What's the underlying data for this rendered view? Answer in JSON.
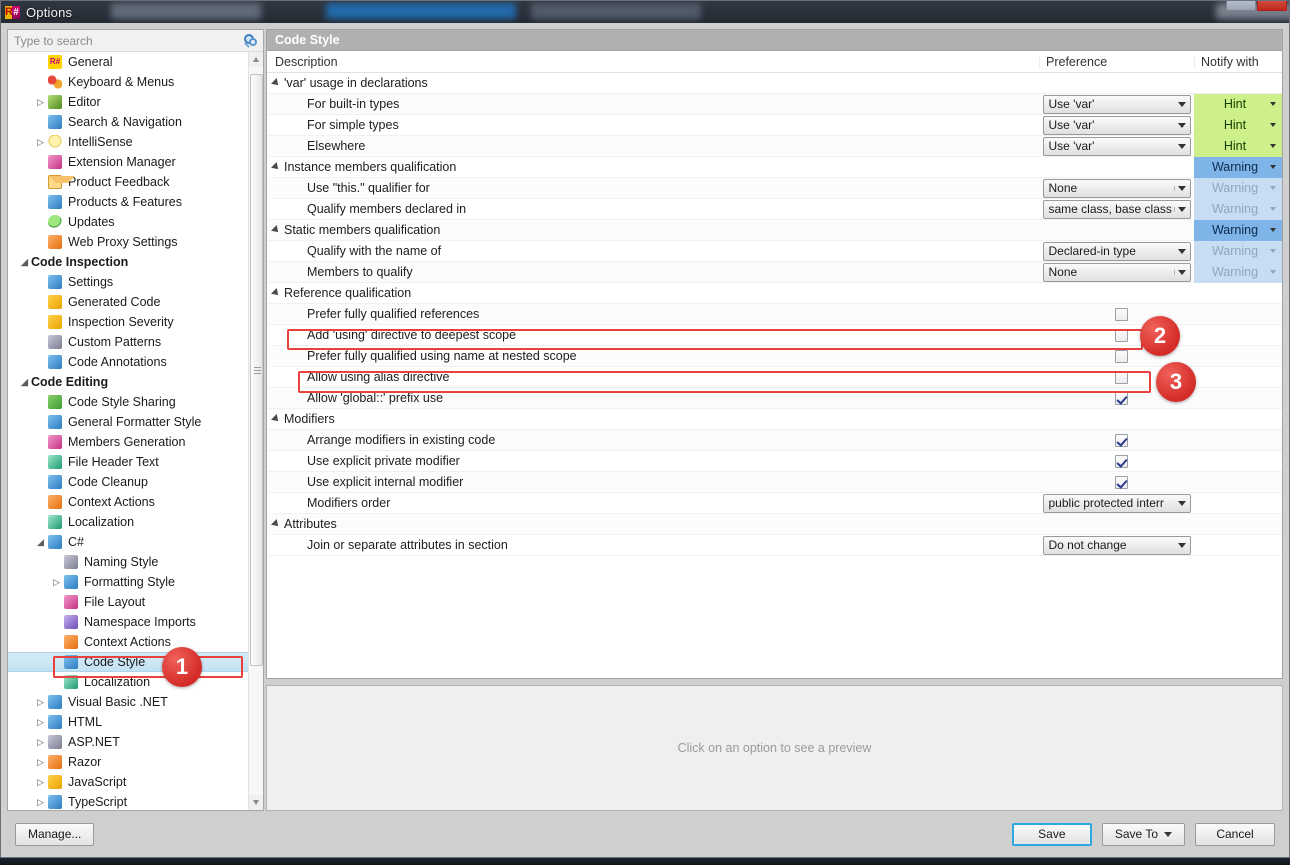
{
  "window": {
    "title": "Options",
    "app_icon": "resharper-icon",
    "minimize_label": "_",
    "close_label": "X"
  },
  "sidebar": {
    "search": {
      "placeholder": "Type to search",
      "value": "",
      "icon": "search-icon"
    },
    "scrollbar": {
      "up_icon": "scroll-up-arrow-icon",
      "down_icon": "scroll-down-arrow-icon"
    },
    "items": [
      {
        "label": "General",
        "indent": 1,
        "expander": "",
        "icon": "resharper-icon",
        "group": false,
        "selected": false
      },
      {
        "label": "Keyboard & Menus",
        "indent": 1,
        "expander": "",
        "icon": "keyboard-menus-icon",
        "group": false,
        "selected": false
      },
      {
        "label": "Editor",
        "indent": 1,
        "expander": "▷",
        "icon": "editor-pencil-icon",
        "group": false,
        "selected": false
      },
      {
        "label": "Search & Navigation",
        "indent": 1,
        "expander": "",
        "icon": "magnifier-icon",
        "group": false,
        "selected": false
      },
      {
        "label": "IntelliSense",
        "indent": 1,
        "expander": "▷",
        "icon": "lightbulb-icon",
        "group": false,
        "selected": false
      },
      {
        "label": "Extension Manager",
        "indent": 1,
        "expander": "",
        "icon": "extension-manager-icon",
        "group": false,
        "selected": false
      },
      {
        "label": "Product Feedback",
        "indent": 1,
        "expander": "",
        "icon": "envelope-icon",
        "group": false,
        "selected": false
      },
      {
        "label": "Products & Features",
        "indent": 1,
        "expander": "",
        "icon": "products-features-icon",
        "group": false,
        "selected": false
      },
      {
        "label": "Updates",
        "indent": 1,
        "expander": "",
        "icon": "updates-globe-icon",
        "group": false,
        "selected": false
      },
      {
        "label": "Web Proxy Settings",
        "indent": 1,
        "expander": "",
        "icon": "web-proxy-icon",
        "group": false,
        "selected": false
      },
      {
        "label": "Code Inspection",
        "indent": 0,
        "expander": "◢",
        "icon": "",
        "group": true,
        "selected": false
      },
      {
        "label": "Settings",
        "indent": 1,
        "expander": "",
        "icon": "settings-icon",
        "group": false,
        "selected": false
      },
      {
        "label": "Generated Code",
        "indent": 1,
        "expander": "",
        "icon": "generated-code-icon",
        "group": false,
        "selected": false
      },
      {
        "label": "Inspection Severity",
        "indent": 1,
        "expander": "",
        "icon": "inspection-severity-icon",
        "group": false,
        "selected": false
      },
      {
        "label": "Custom Patterns",
        "indent": 1,
        "expander": "",
        "icon": "custom-patterns-icon",
        "group": false,
        "selected": false
      },
      {
        "label": "Code Annotations",
        "indent": 1,
        "expander": "",
        "icon": "code-annotations-icon",
        "group": false,
        "selected": false
      },
      {
        "label": "Code Editing",
        "indent": 0,
        "expander": "◢",
        "icon": "",
        "group": true,
        "selected": false
      },
      {
        "label": "Code Style Sharing",
        "indent": 1,
        "expander": "",
        "icon": "code-style-sharing-icon",
        "group": false,
        "selected": false
      },
      {
        "label": "General Formatter Style",
        "indent": 1,
        "expander": "",
        "icon": "formatter-style-icon",
        "group": false,
        "selected": false
      },
      {
        "label": "Members Generation",
        "indent": 1,
        "expander": "",
        "icon": "members-generation-icon",
        "group": false,
        "selected": false
      },
      {
        "label": "File Header Text",
        "indent": 1,
        "expander": "",
        "icon": "file-header-icon",
        "group": false,
        "selected": false
      },
      {
        "label": "Code Cleanup",
        "indent": 1,
        "expander": "",
        "icon": "code-cleanup-icon",
        "group": false,
        "selected": false
      },
      {
        "label": "Context Actions",
        "indent": 1,
        "expander": "",
        "icon": "context-actions-icon",
        "group": false,
        "selected": false
      },
      {
        "label": "Localization",
        "indent": 1,
        "expander": "",
        "icon": "localization-icon",
        "group": false,
        "selected": false
      },
      {
        "label": "C#",
        "indent": 1,
        "expander": "◢",
        "icon": "csharp-icon",
        "group": false,
        "selected": false
      },
      {
        "label": "Naming Style",
        "indent": 2,
        "expander": "",
        "icon": "naming-style-icon",
        "group": false,
        "selected": false
      },
      {
        "label": "Formatting Style",
        "indent": 2,
        "expander": "▷",
        "icon": "formatting-style-icon",
        "group": false,
        "selected": false
      },
      {
        "label": "File Layout",
        "indent": 2,
        "expander": "",
        "icon": "file-layout-icon",
        "group": false,
        "selected": false
      },
      {
        "label": "Namespace Imports",
        "indent": 2,
        "expander": "",
        "icon": "namespace-imports-icon",
        "group": false,
        "selected": false
      },
      {
        "label": "Context Actions",
        "indent": 2,
        "expander": "",
        "icon": "context-actions-icon",
        "group": false,
        "selected": false
      },
      {
        "label": "Code Style",
        "indent": 2,
        "expander": "",
        "icon": "code-style-icon",
        "group": false,
        "selected": true
      },
      {
        "label": "Localization",
        "indent": 2,
        "expander": "",
        "icon": "localization-icon",
        "group": false,
        "selected": false
      },
      {
        "label": "Visual Basic .NET",
        "indent": 1,
        "expander": "▷",
        "icon": "vb-net-icon",
        "group": false,
        "selected": false
      },
      {
        "label": "HTML",
        "indent": 1,
        "expander": "▷",
        "icon": "html-icon",
        "group": false,
        "selected": false
      },
      {
        "label": "ASP.NET",
        "indent": 1,
        "expander": "▷",
        "icon": "aspnet-icon",
        "group": false,
        "selected": false
      },
      {
        "label": "Razor",
        "indent": 1,
        "expander": "▷",
        "icon": "razor-icon",
        "group": false,
        "selected": false
      },
      {
        "label": "JavaScript",
        "indent": 1,
        "expander": "▷",
        "icon": "javascript-icon",
        "group": false,
        "selected": false
      },
      {
        "label": "TypeScript",
        "indent": 1,
        "expander": "▷",
        "icon": "typescript-icon",
        "group": false,
        "selected": false
      }
    ]
  },
  "main": {
    "header": "Code Style",
    "columns": {
      "description": "Description",
      "preference": "Preference",
      "notify": "Notify with"
    },
    "rows": [
      {
        "label": "'var' usage in declarations",
        "type": "group",
        "preference": null,
        "notify": null,
        "checkbox": null
      },
      {
        "label": "For built-in types",
        "type": "item",
        "preference": "Use 'var'",
        "combo_style": "wide",
        "notify": "Hint",
        "notify_state": "hint",
        "checkbox": null
      },
      {
        "label": "For simple types",
        "type": "item",
        "preference": "Use 'var'",
        "combo_style": "wide",
        "notify": "Hint",
        "notify_state": "hint",
        "checkbox": null
      },
      {
        "label": "Elsewhere",
        "type": "item",
        "preference": "Use 'var'",
        "combo_style": "wide",
        "notify": "Hint",
        "notify_state": "hint",
        "checkbox": null
      },
      {
        "label": "Instance members qualification",
        "type": "group",
        "preference": null,
        "notify": "Warning",
        "notify_state": "warning-active",
        "checkbox": null
      },
      {
        "label": "Use \"this.\" qualifier for",
        "type": "item",
        "preference": "None",
        "combo_style": "narrow",
        "notify": "Warning",
        "notify_state": "warning-dim",
        "checkbox": null
      },
      {
        "label": "Qualify members declared in",
        "type": "item",
        "preference": "same class, base class",
        "combo_style": "narrow",
        "notify": "Warning",
        "notify_state": "warning-dim",
        "checkbox": null
      },
      {
        "label": "Static members qualification",
        "type": "group",
        "preference": null,
        "notify": "Warning",
        "notify_state": "warning-active",
        "checkbox": null
      },
      {
        "label": "Qualify with the name of",
        "type": "item",
        "preference": "Declared-in type",
        "combo_style": "wide",
        "notify": "Warning",
        "notify_state": "warning-dim",
        "checkbox": null
      },
      {
        "label": "Members to qualify",
        "type": "item",
        "preference": "None",
        "combo_style": "narrow",
        "notify": "Warning",
        "notify_state": "warning-dim",
        "checkbox": null
      },
      {
        "label": "Reference qualification",
        "type": "group",
        "preference": null,
        "notify": null,
        "checkbox": null
      },
      {
        "label": "Prefer fully qualified references",
        "type": "item",
        "preference": null,
        "notify": null,
        "checkbox": false
      },
      {
        "label": "Add 'using' directive to deepest scope",
        "type": "item",
        "preference": null,
        "notify": null,
        "checkbox": false
      },
      {
        "label": "Prefer fully qualified using name at nested scope",
        "type": "item",
        "preference": null,
        "notify": null,
        "checkbox": false
      },
      {
        "label": "Allow using alias directive",
        "type": "item",
        "preference": null,
        "notify": null,
        "checkbox": false
      },
      {
        "label": "Allow 'global::' prefix use",
        "type": "item",
        "preference": null,
        "notify": null,
        "checkbox": true
      },
      {
        "label": "Modifiers",
        "type": "group",
        "preference": null,
        "notify": null,
        "checkbox": null
      },
      {
        "label": "Arrange modifiers in existing code",
        "type": "item",
        "preference": null,
        "notify": null,
        "checkbox": true
      },
      {
        "label": "Use explicit private modifier",
        "type": "item",
        "preference": null,
        "notify": null,
        "checkbox": true
      },
      {
        "label": "Use explicit internal modifier",
        "type": "item",
        "preference": null,
        "notify": null,
        "checkbox": true
      },
      {
        "label": "Modifiers order",
        "type": "item",
        "preference": "public protected interr",
        "combo_style": "wide",
        "notify": null,
        "checkbox": null
      },
      {
        "label": "Attributes",
        "type": "group",
        "preference": null,
        "notify": null,
        "checkbox": null
      },
      {
        "label": "Join or separate attributes in section",
        "type": "item",
        "preference": "Do not change",
        "combo_style": "wide",
        "notify": null,
        "checkbox": null
      }
    ],
    "preview_placeholder": "Click on an option to see a preview"
  },
  "footer": {
    "manage": "Manage...",
    "save": "Save",
    "save_to": "Save To",
    "cancel": "Cancel"
  },
  "annotations": [
    {
      "id": "1",
      "label": "1",
      "target": "sidebar-item-code-style"
    },
    {
      "id": "2",
      "label": "2",
      "target": "row-add-using-directive-to-deepest-scope"
    },
    {
      "id": "3",
      "label": "3",
      "target": "row-allow-using-alias-directive"
    }
  ],
  "colors": {
    "accent_red": "#e8423c",
    "hint_green": "#cdf08b",
    "warning_blue": "#7fb4e8",
    "warning_blue_dim": "#c8ddf2",
    "selection_blue": "#c3e2f3",
    "header_gray": "#b0b0b0"
  }
}
